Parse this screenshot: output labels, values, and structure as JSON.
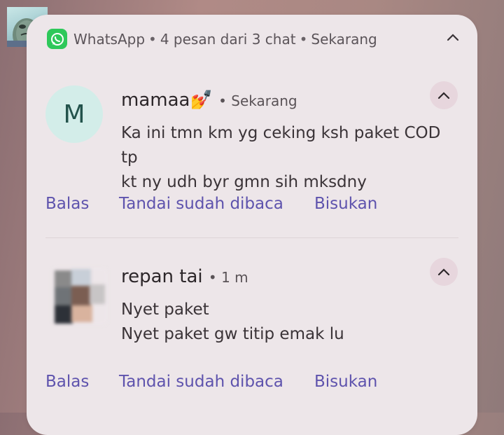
{
  "header": {
    "app_name": "WhatsApp",
    "summary": "4 pesan dari 3 chat",
    "time": "Sekarang",
    "separator": "•"
  },
  "icons": {
    "app": "whatsapp-icon",
    "expand": "chevron-up-icon"
  },
  "colors": {
    "whatsapp_green": "#2ec85a",
    "action_text": "#5e53ad",
    "avatar_m_bg": "#d3ede9"
  },
  "messages": [
    {
      "avatar_letter": "M",
      "sender": "mamaa💅",
      "time": "Sekarang",
      "lines": [
        "Ka ini tmn km yg ceking ksh paket COD tp",
        "kt ny udh byr gmn sih mksdny"
      ],
      "actions": [
        "Balas",
        "Tandai sudah dibaca",
        "Bisukan"
      ]
    },
    {
      "sender": "repan tai",
      "time": "1 m",
      "lines": [
        "Nyet paket",
        "Nyet paket gw titip emak lu"
      ],
      "actions": [
        "Balas",
        "Tandai sudah dibaca",
        "Bisukan"
      ]
    }
  ]
}
